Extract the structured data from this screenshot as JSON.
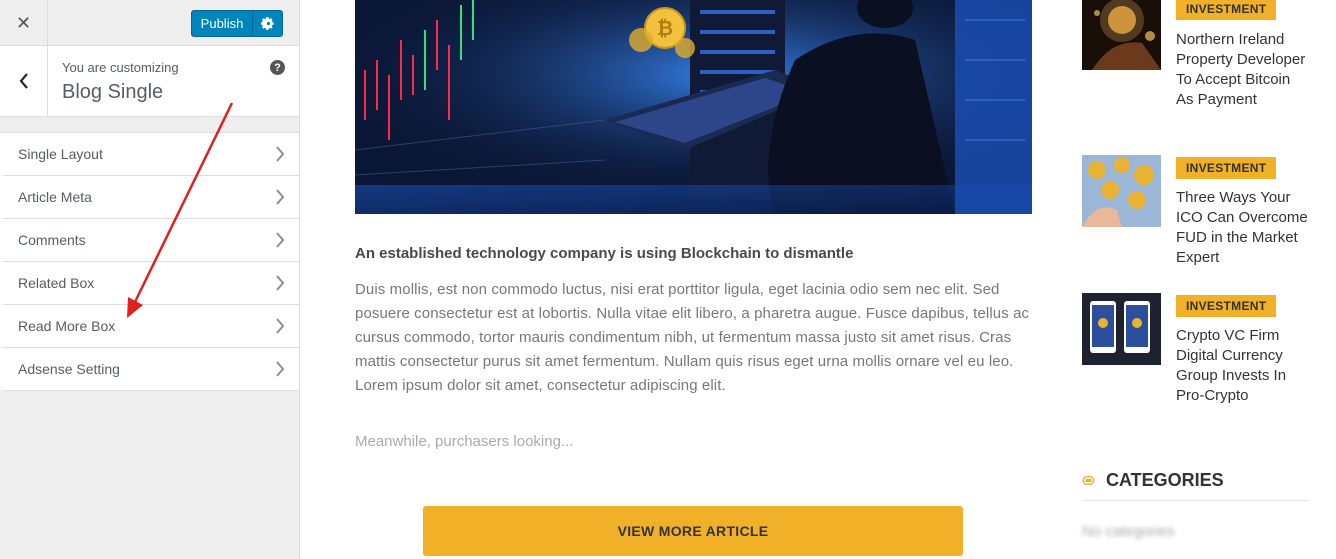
{
  "customizer": {
    "publish_label": "Publish",
    "customizing_label": "You are customizing",
    "section_title": "Blog Single",
    "help_glyph": "?",
    "close_glyph": "✕",
    "menu": [
      {
        "label": "Single Layout"
      },
      {
        "label": "Article Meta"
      },
      {
        "label": "Comments"
      },
      {
        "label": "Related Box"
      },
      {
        "label": "Read More Box"
      },
      {
        "label": "Adsense Setting"
      }
    ]
  },
  "article": {
    "heading": "An established technology company is using Blockchain to dismantle",
    "body": "Duis mollis, est non commodo luctus, nisi erat porttitor ligula, eget lacinia odio sem nec elit. Sed posuere consectetur est at lobortis. Nulla vitae elit libero, a pharetra augue. Fusce dapibus, tellus ac cursus commodo, tortor mauris condimentum nibh, ut fermentum massa justo sit amet risus. Cras mattis consectetur purus sit amet fermentum. Nullam quis risus eget urna mollis ornare vel eu leo. Lorem ipsum dolor sit amet, consectetur adipiscing elit.",
    "more_text": "Meanwhile, purchasers looking...",
    "view_more_label": "VIEW MORE ARTICLE"
  },
  "sidebar_posts": [
    {
      "badge": "INVESTMENT",
      "title": "Northern Ireland Property Developer To Accept Bitcoin As Payment"
    },
    {
      "badge": "INVESTMENT",
      "title": "Three Ways Your ICO Can Overcome FUD in the Market Expert"
    },
    {
      "badge": "INVESTMENT",
      "title": "Crypto VC Firm Digital Currency Group Invests In Pro-Crypto"
    }
  ],
  "categories": {
    "title": "CATEGORIES",
    "empty_text": "No categories"
  },
  "colors": {
    "accent": "#f0b028",
    "publish_blue": "#0085ba",
    "annotation_red": "#e0201e"
  }
}
